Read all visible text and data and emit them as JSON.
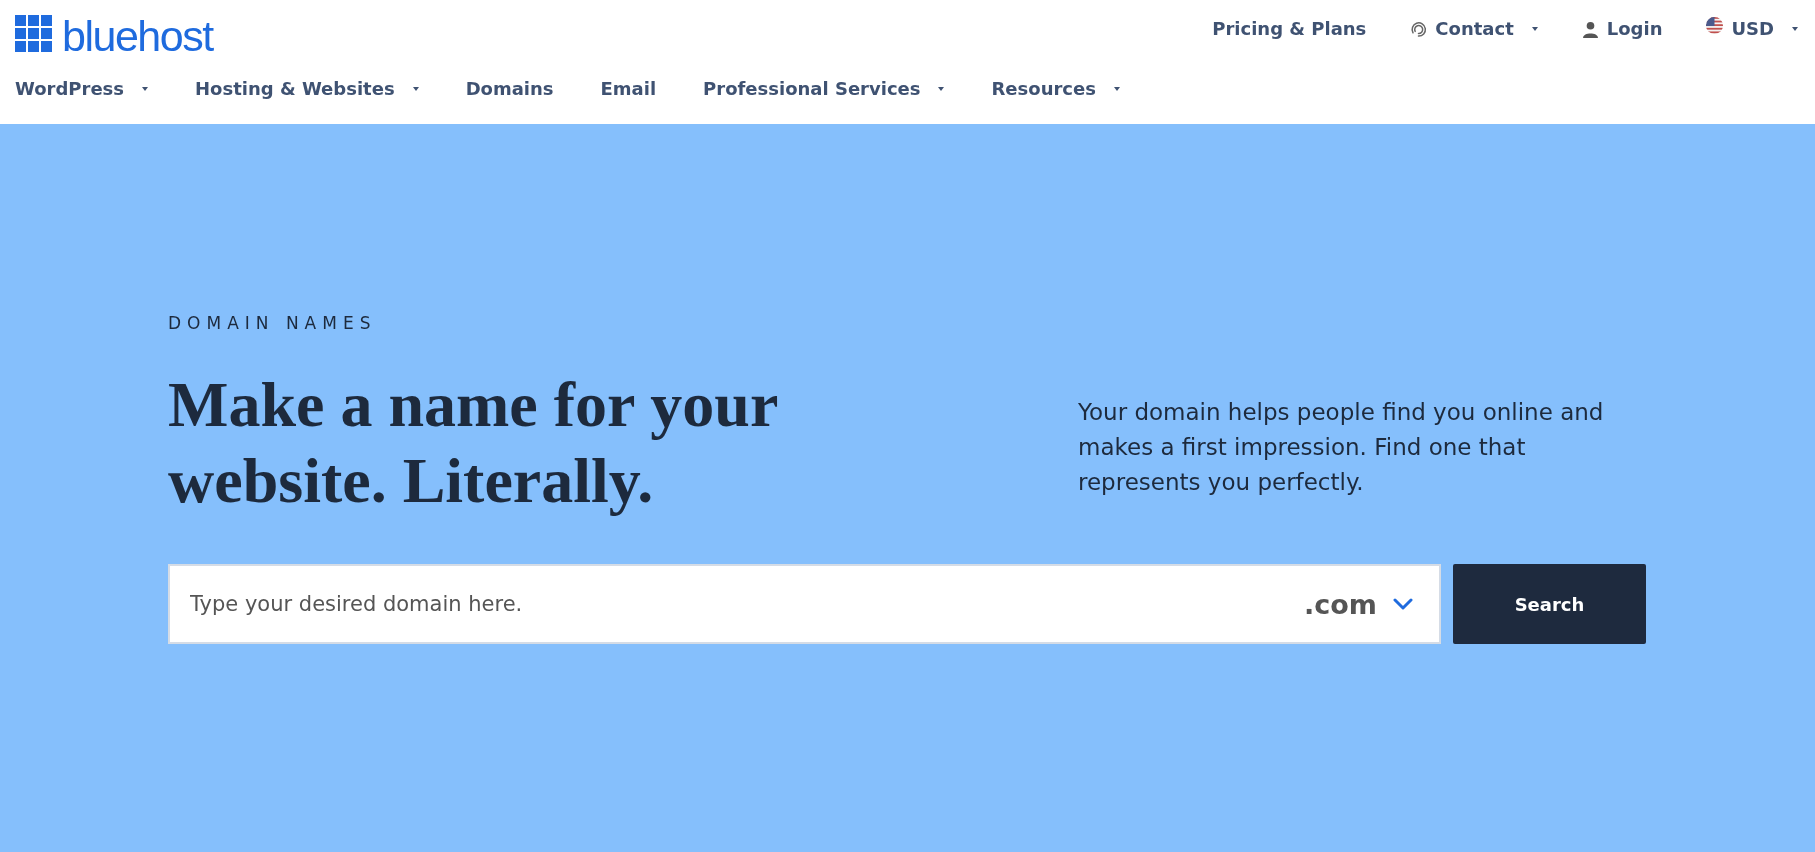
{
  "logo": {
    "text": "bluehost"
  },
  "top_nav": [
    {
      "label": "Pricing & Plans",
      "kind": "link",
      "dropdown": false
    },
    {
      "label": "Contact",
      "kind": "contact",
      "dropdown": true
    },
    {
      "label": "Login",
      "kind": "account",
      "dropdown": false
    },
    {
      "label": "USD",
      "kind": "currency",
      "dropdown": true
    }
  ],
  "main_nav": [
    {
      "label": "WordPress",
      "dropdown": true
    },
    {
      "label": "Hosting & Websites",
      "dropdown": true
    },
    {
      "label": "Domains",
      "dropdown": false
    },
    {
      "label": "Email",
      "dropdown": false
    },
    {
      "label": "Professional Services",
      "dropdown": true
    },
    {
      "label": "Resources",
      "dropdown": true
    }
  ],
  "hero": {
    "eyebrow": "DOMAIN NAMES",
    "heading": "Make a name for your website. Literally.",
    "description": "Your domain helps people find you online and makes a first impression. Find one that represents you perfectly.",
    "search": {
      "placeholder": "Type your desired domain here.",
      "extension": ".com",
      "button": "Search"
    }
  }
}
